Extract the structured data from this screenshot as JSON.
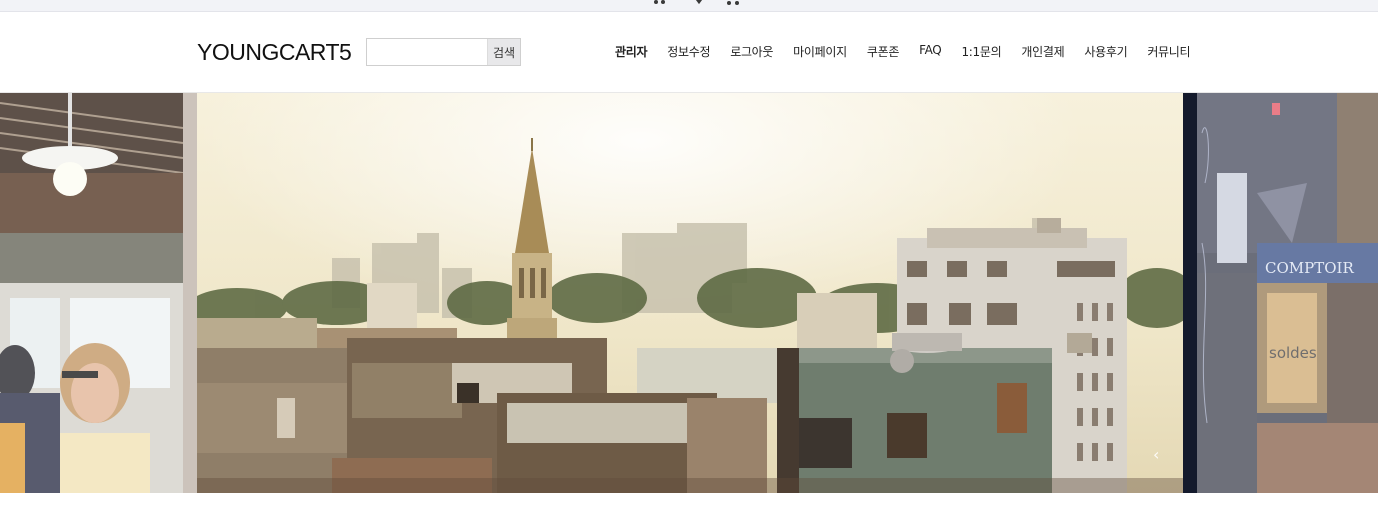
{
  "header": {
    "logo": "YOUNGCART5",
    "search": {
      "value": "",
      "placeholder": "",
      "button_label": "검색"
    },
    "nav": [
      {
        "label": "관리자",
        "bold": true
      },
      {
        "label": "정보수정"
      },
      {
        "label": "로그아웃"
      },
      {
        "label": "마이페이지"
      },
      {
        "label": "쿠폰존"
      },
      {
        "label": "FAQ"
      },
      {
        "label": "1:1문의"
      },
      {
        "label": "개인결제"
      },
      {
        "label": "사용후기"
      },
      {
        "label": "커뮤니티"
      }
    ]
  },
  "topbar": {
    "icons": [
      "cart-icon",
      "heart-icon",
      "cart-icon"
    ]
  },
  "slider": {
    "slides": [
      "cafe-interior-image",
      "city-rooftops-image",
      "shop-front-image"
    ],
    "signage": [
      "COMPTOIR",
      "soldes"
    ],
    "controls": {
      "prev": "‹",
      "play": "▶",
      "pause": "❚❚",
      "next": "›"
    }
  },
  "colors": {
    "header_border": "#e8e8e8",
    "search_button_bg": "#e8e8ea"
  }
}
